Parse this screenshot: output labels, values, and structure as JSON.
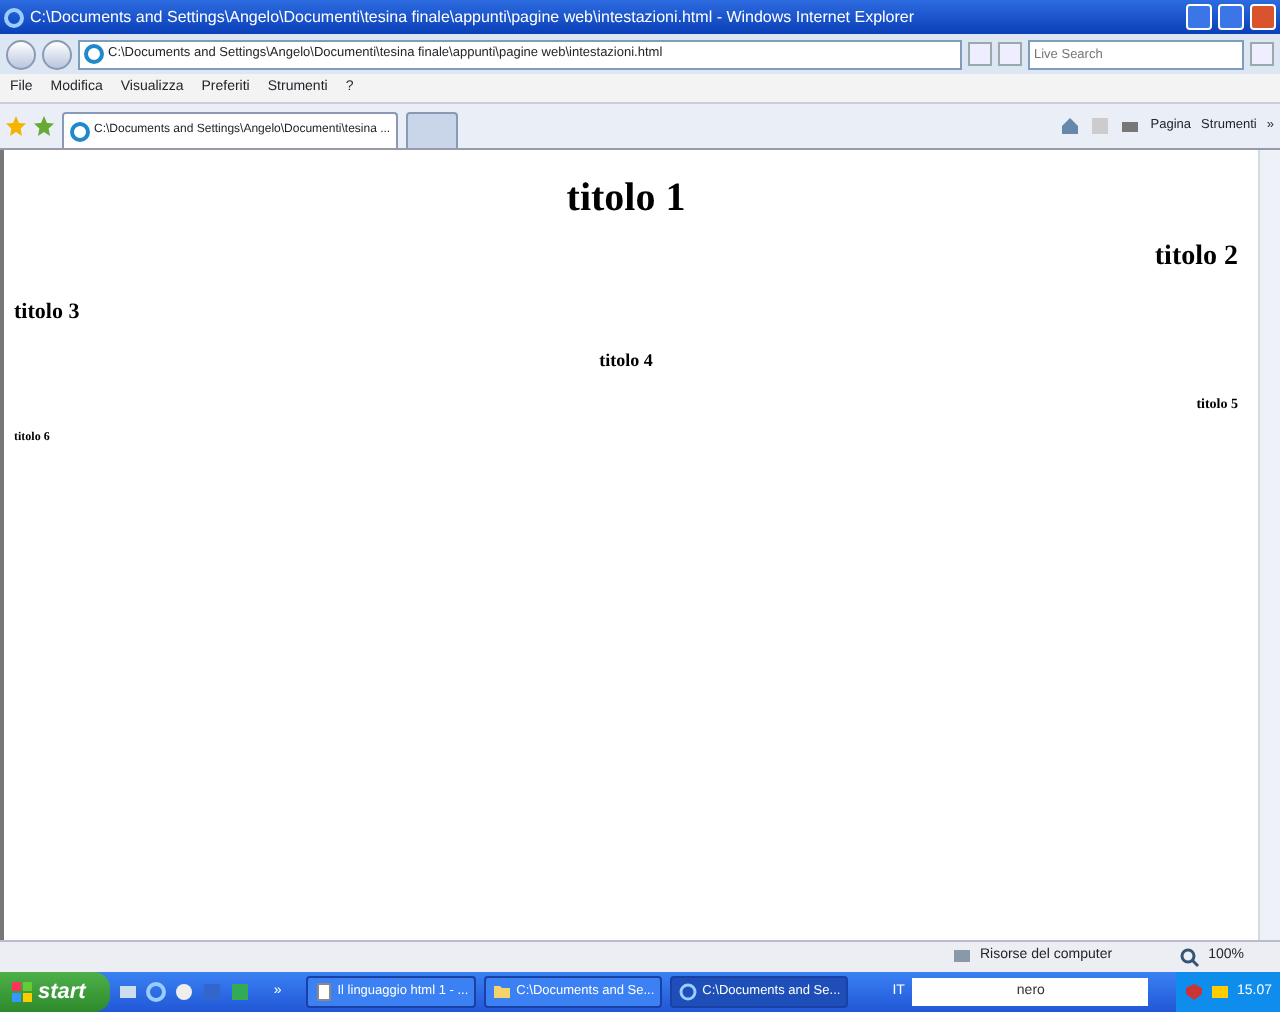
{
  "window": {
    "title": "C:\\Documents and Settings\\Angelo\\Documenti\\tesina finale\\appunti\\pagine web\\intestazioni.html - Windows Internet Explorer"
  },
  "address_bar": {
    "url": "C:\\Documents and Settings\\Angelo\\Documenti\\tesina finale\\appunti\\pagine web\\intestazioni.html"
  },
  "search": {
    "placeholder": "Live Search"
  },
  "menu": [
    "File",
    "Modifica",
    "Visualizza",
    "Preferiti",
    "Strumenti",
    "?"
  ],
  "tabs": [
    {
      "label": "C:\\Documents and Settings\\Angelo\\Documenti\\tesina ...",
      "selected": true
    }
  ],
  "command_bar": {
    "page": "Pagina",
    "tools": "Strumenti",
    "more": "»"
  },
  "headings": [
    {
      "text": "titolo 1",
      "kind": "h1"
    },
    {
      "text": "titolo 2",
      "kind": "h2"
    },
    {
      "text": "titolo 3",
      "kind": "h3"
    },
    {
      "text": "titolo 4",
      "kind": "h4"
    },
    {
      "text": "titolo 5",
      "kind": "h5"
    },
    {
      "text": "titolo 6",
      "kind": "h6"
    }
  ],
  "status_bar": {
    "zone": "Risorse del computer",
    "zoom": "100%"
  },
  "taskbar": {
    "start": "start",
    "more": "»",
    "tasks": [
      {
        "label": "Il linguaggio html 1 - ...",
        "kind": "document",
        "selected": false
      },
      {
        "label": "C:\\Documents and Se...",
        "kind": "folder",
        "selected": false
      },
      {
        "label": "C:\\Documents and Se...",
        "kind": "browser",
        "selected": true
      }
    ],
    "language": "IT",
    "toolbar_logo": "nero",
    "clock": "15.07"
  }
}
